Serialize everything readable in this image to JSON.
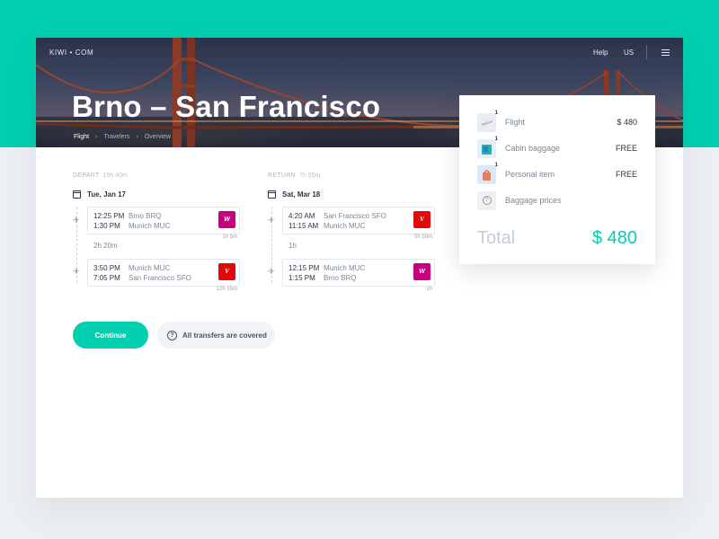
{
  "header": {
    "brand": "KIWI • COM",
    "help": "Help",
    "locale": "US",
    "title": "Brno – San Francisco",
    "breadcrumbs": [
      "Flight",
      "Travelers",
      "Overview"
    ],
    "breadcrumb_separator": "›"
  },
  "depart": {
    "label": "DEPART",
    "duration": "15h 40m",
    "date": "Tue, Jan 17",
    "segments": [
      {
        "time_dep": "12:25 PM",
        "time_arr": "1:30 PM",
        "from": "Brno BRQ",
        "to": "Munich MUC",
        "airline_logo": "Wizz",
        "duration": "1h 5m"
      },
      {
        "time_dep": "3:50 PM",
        "time_arr": "7:05 PM",
        "from": "Munich MUC",
        "to": "San Francisco SFO",
        "airline_logo": "Virgin",
        "duration": "12h 15m"
      }
    ],
    "layover": "2h 20m"
  },
  "return": {
    "label": "RETURN",
    "duration": "7h 55m",
    "date": "Sat, Mar 18",
    "segments": [
      {
        "time_dep": "4:20 AM",
        "time_arr": "11:15 AM",
        "from": "San Francisco SFO",
        "to": "Munich MUC",
        "airline_logo": "Virgin",
        "duration": "5h 55m"
      },
      {
        "time_dep": "12:15 PM",
        "time_arr": "1:15 PM",
        "from": "Munich MUC",
        "to": "Brno BRQ",
        "airline_logo": "Wizz",
        "duration": "1h"
      }
    ],
    "layover": "1h"
  },
  "actions": {
    "continue": "Continue",
    "transfers": "All transfers are covered"
  },
  "summary": {
    "items": [
      {
        "label": "Flight",
        "value": "$ 480",
        "badge": "1",
        "icon": "flight-ticket-icon"
      },
      {
        "label": "Cabin baggage",
        "value": "FREE",
        "badge": "1",
        "icon": "cabin-bag-icon"
      },
      {
        "label": "Personal item",
        "value": "FREE",
        "badge": "1",
        "icon": "personal-item-icon"
      },
      {
        "label": "Baggage prices",
        "value": "",
        "badge": "",
        "icon": "question-icon"
      }
    ],
    "total_label": "Total",
    "total_value": "$ 480"
  },
  "colors": {
    "accent": "#02cfb0",
    "wizz": "#c6007e",
    "virgin": "#e10a0a"
  }
}
